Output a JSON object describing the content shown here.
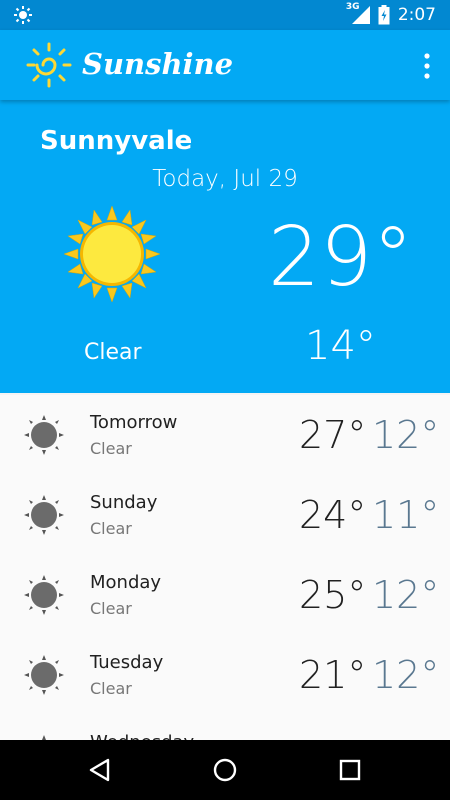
{
  "status_bar": {
    "time": "2:07",
    "network": "3G",
    "icons": [
      "brightness-icon",
      "signal-icon",
      "battery-icon"
    ]
  },
  "app": {
    "title": "Sunshine"
  },
  "today": {
    "city": "Sunnyvale",
    "date": "Today, Jul 29",
    "high": "29°",
    "low": "14°",
    "condition": "Clear",
    "icon": "sun-icon"
  },
  "forecast": [
    {
      "day": "Tomorrow",
      "condition": "Clear",
      "high": "27°",
      "low": "12°"
    },
    {
      "day": "Sunday",
      "condition": "Clear",
      "high": "24°",
      "low": "11°"
    },
    {
      "day": "Monday",
      "condition": "Clear",
      "high": "25°",
      "low": "12°"
    },
    {
      "day": "Tuesday",
      "condition": "Clear",
      "high": "21°",
      "low": "12°"
    },
    {
      "day": "Wednesday",
      "condition": "",
      "high": "",
      "low": ""
    }
  ],
  "colors": {
    "primary": "#03a9f4",
    "primary_dark": "#0288d1",
    "low_temp": "#5a7890",
    "sun_yellow": "#fdd835"
  },
  "navigation": {
    "buttons": [
      "back-icon",
      "home-icon",
      "recents-icon"
    ]
  }
}
